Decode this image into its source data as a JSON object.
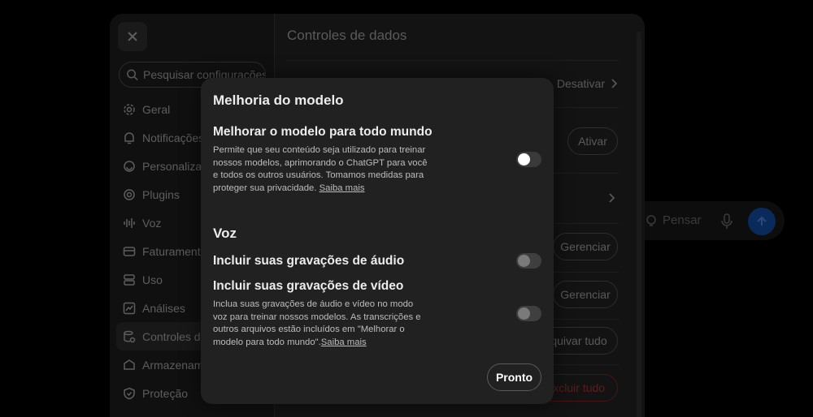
{
  "background_chat": {
    "think_label": "Pensar",
    "think_icon": "lightbulb-icon",
    "mic_icon": "microphone-icon",
    "send_icon": "arrow-up-icon"
  },
  "settings": {
    "close_icon": "close-icon",
    "search": {
      "placeholder": "Pesquisar configurações"
    },
    "nav": [
      {
        "label": "Geral",
        "icon": "gear-icon"
      },
      {
        "label": "Notificações",
        "icon": "bell-icon"
      },
      {
        "label": "Personalização",
        "icon": "personalization-icon"
      },
      {
        "label": "Plugins",
        "icon": "at-icon"
      },
      {
        "label": "Voz",
        "icon": "waveform-icon"
      },
      {
        "label": "Faturamento",
        "icon": "billing-icon"
      },
      {
        "label": "Uso",
        "icon": "usage-icon"
      },
      {
        "label": "Análises",
        "icon": "chart-icon"
      },
      {
        "label": "Controles de dados",
        "icon": "database-icon"
      },
      {
        "label": "Armazenamento",
        "icon": "storage-icon"
      },
      {
        "label": "Proteção",
        "icon": "shield-icon"
      }
    ],
    "content": {
      "title": "Controles de dados",
      "improve_value": "Desativar",
      "activate_button": "Ativar",
      "manage_button_1": "Gerenciar",
      "manage_button_2": "Gerenciar",
      "archive_all_button": "Arquivar tudo",
      "delete_all_button": "Excluir tudo"
    }
  },
  "modal": {
    "title": "Melhoria do modelo",
    "improve": {
      "label": "Melhorar o modelo para todo mundo",
      "description": "Permite que seu conteúdo seja utilizado para treinar nossos modelos, aprimorando o ChatGPT para você e todos os outros usuários. Tomamos medidas para proteger sua privacidade.",
      "link": "Saiba mais",
      "enabled": false
    },
    "voice_section": "Voz",
    "audio": {
      "label": "Incluir suas gravações de áudio",
      "enabled": false
    },
    "video": {
      "label": "Incluir suas gravações de vídeo",
      "description": "Inclua suas gravações de áudio e vídeo no modo voz para treinar nossos modelos. As transcrições e outros arquivos estão incluídos em \"Melhorar o modelo para todo mundo\".",
      "link": "Saiba mais",
      "enabled": false
    },
    "done_button": "Pronto"
  }
}
